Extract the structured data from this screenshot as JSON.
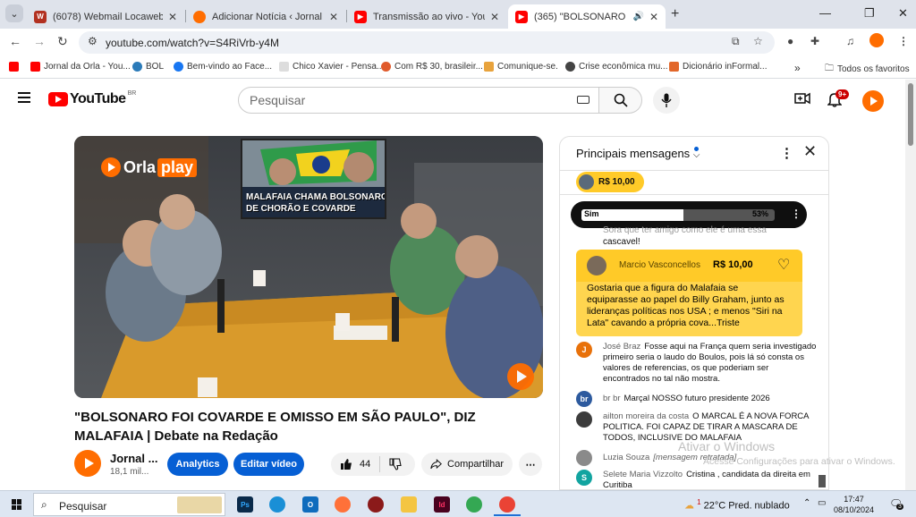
{
  "browser": {
    "tabs": [
      {
        "title": "(6078) Webmail Locaweb :: Cai",
        "favicon": "W",
        "color": "#b23121"
      },
      {
        "title": "Adicionar Notícia ‹ Jornal da Or",
        "favicon": "",
        "color": "#ff6d00"
      },
      {
        "title": "Transmissão ao vivo - YouTube",
        "favicon": "",
        "color": "#ff0000"
      },
      {
        "title": "(365) \"BOLSONARO FOI CO",
        "favicon": "",
        "color": "#ff0000"
      }
    ],
    "url": "youtube.com/watch?v=S4RiVrb-y4M",
    "bookmarks": [
      "Jornal da Orla - You...",
      "BOL",
      "Bem-vindo ao Face...",
      "Chico Xavier - Pensa...",
      "Com R$ 30, brasileir...",
      "Comunique-se.",
      "Crise econômica mu...",
      "Dicionário inFormal..."
    ],
    "all_favorites": "Todos os favoritos"
  },
  "youtube": {
    "logo_text": "YouTube",
    "region": "BR",
    "search_placeholder": "Pesquisar",
    "notif_count": "9+"
  },
  "video": {
    "overlay_logo": [
      "Orla",
      "play"
    ],
    "overlay_caption_line1": "MALAFAIA CHAMA BOLSONARO",
    "overlay_caption_line2": "DE CHORÃO E COVARDE",
    "title": "\"BOLSONARO FOI COVARDE E OMISSO EM SÃO PAULO\", DIZ MALAFAIA | Debate na Redação",
    "channel": "Jornal ...",
    "subscribers": "18,1 mil...",
    "analytics_label": "Analytics",
    "edit_label": "Editar vídeo",
    "likes": "44",
    "share_label": "Compartilhar"
  },
  "chat": {
    "header": "Principais mensagens",
    "ticker_amount": "R$ 10,00",
    "poll": {
      "option": "Sim",
      "percent_label": "53%",
      "percent": 53
    },
    "partial_message_line1": "Sora que ter amigo como ele é uma essa",
    "partial_message_line2": "cascavel!",
    "superchat": {
      "author": "Marcio Vasconcellos",
      "amount": "R$ 10,00",
      "text": "Gostaria que a figura do Malafaia se equiparasse ao papel do Billy Graham, junto as lideranças políticas nos USA ; e menos \"Siri na Lata\" cavando a própria cova...Triste"
    },
    "messages": [
      {
        "initial": "J",
        "color": "#e8710a",
        "author": "José Braz",
        "text": "Fosse aqui na França quem seria investigado primeiro seria o laudo do Boulos, pois lá só consta os valores de referencias, os que poderiam ser encontrados no tal não mostra."
      },
      {
        "initial": "br",
        "color": "#2d5a9e",
        "author": "br br",
        "text": "Marçal NOSSO futuro presidente 2026"
      },
      {
        "initial": "",
        "color": "#3c3c3c",
        "author": "ailton moreira da costa",
        "text": "O MARCAL É A NOVA FORCA POLITICA. FOI CAPAZ DE TIRAR A MASCARA DE TODOS, INCLUSIVE DO MALAFAIA"
      },
      {
        "initial": "",
        "color": "#8a8a8a",
        "author": "Luzia Souza",
        "text": "[mensagem retratada]"
      },
      {
        "initial": "S",
        "color": "#12a4a0",
        "author": "Selete Maria Vizzolto",
        "text": "Cristina , candidata da direita em Curitiba"
      }
    ]
  },
  "windows": {
    "activate_title": "Ativar o Windows",
    "activate_sub": "Acesse Configurações para ativar o Windows.",
    "search_placeholder": "Pesquisar",
    "weather": "22°C  Pred. nublado",
    "weather_badge": "1",
    "time": "17:47",
    "date": "08/10/2024",
    "notifications": "3"
  }
}
